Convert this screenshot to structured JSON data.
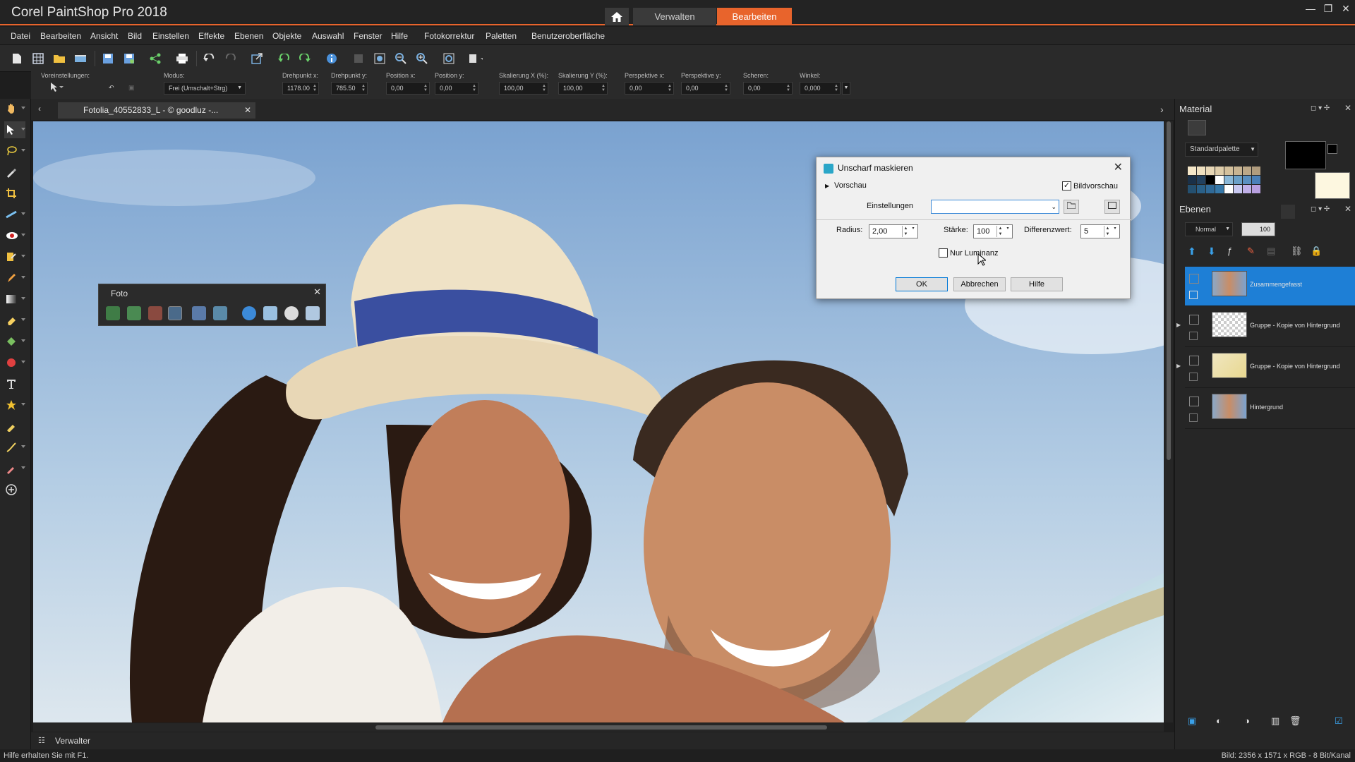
{
  "app": {
    "title": "Corel PaintShop Pro 2018"
  },
  "workspace": {
    "manage": "Verwalten",
    "edit": "Bearbeiten"
  },
  "menu": [
    "Datei",
    "Bearbeiten",
    "Ansicht",
    "Bild",
    "Einstellen",
    "Effekte",
    "Ebenen",
    "Objekte",
    "Auswahl",
    "Fenster",
    "Hilfe",
    "Fotokorrektur",
    "Paletten",
    "Benutzeroberfläche"
  ],
  "tool_options": {
    "presets_label": "Voreinstellungen:",
    "mode_label": "Modus:",
    "mode_value": "Frei (Umschalt+Strg)",
    "fields": [
      {
        "label": "Drehpunkt x:",
        "value": "1178.00"
      },
      {
        "label": "Drehpunkt y:",
        "value": "785.50"
      },
      {
        "label": "Position x:",
        "value": "0,00"
      },
      {
        "label": "Position y:",
        "value": "0,00"
      },
      {
        "label": "Skalierung X (%):",
        "value": "100,00"
      },
      {
        "label": "Skalierung Y (%):",
        "value": "100,00"
      },
      {
        "label": "Perspektive x:",
        "value": "0,00"
      },
      {
        "label": "Perspektive y:",
        "value": "0,00"
      },
      {
        "label": "Scheren:",
        "value": "0,00"
      },
      {
        "label": "Winkel:",
        "value": "0,000"
      }
    ]
  },
  "document": {
    "tab": "Fotolia_40552833_L - © goodluz -..."
  },
  "foto_palette": {
    "title": "Foto"
  },
  "dialog": {
    "title": "Unscharf maskieren",
    "preview": "Vorschau",
    "image_preview": "Bildvorschau",
    "settings": "Einstellungen",
    "radius_label": "Radius:",
    "radius_value": "2,00",
    "strength_label": "Stärke:",
    "strength_value": "100",
    "threshold_label": "Differenzwert:",
    "threshold_value": "5",
    "luminance_only": "Nur Luminanz",
    "ok": "OK",
    "cancel": "Abbrechen",
    "help": "Hilfe"
  },
  "material": {
    "title": "Material",
    "palette": "Standardpalette"
  },
  "layers": {
    "title": "Ebenen",
    "blend_mode": "Normal",
    "opacity": "100",
    "items": [
      {
        "name": "Zusammengefasst",
        "selected": true
      },
      {
        "name": "Gruppe - Kopie von Hintergrund",
        "selected": false
      },
      {
        "name": "Gruppe - Kopie von Hintergrund",
        "selected": false
      },
      {
        "name": "Hintergrund",
        "selected": false
      }
    ]
  },
  "bottom": {
    "manager": "Verwalter"
  },
  "status": {
    "hint": "Hilfe erhalten Sie mit F1.",
    "info": "Bild: 2356 x 1571 x RGB - 8 Bit/Kanal"
  },
  "colors": {
    "accent": "#e8642c",
    "selection": "#1e7fd6",
    "background": "#262626"
  }
}
